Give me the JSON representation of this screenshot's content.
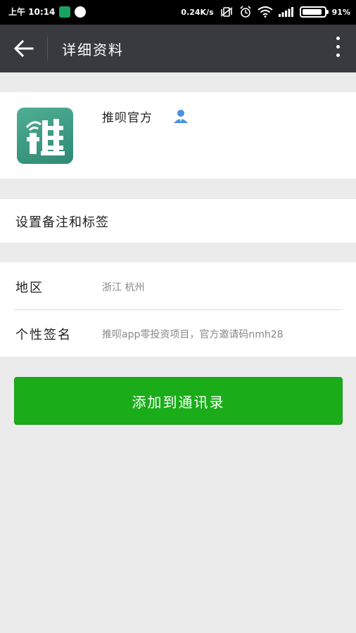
{
  "status_bar": {
    "time": "上午 10:14",
    "net_speed": "0.24K/s",
    "battery": "91%"
  },
  "header": {
    "title": "详细资料"
  },
  "profile": {
    "name": "推呗官方",
    "logo_text": "推"
  },
  "remark": {
    "label": "设置备注和标签"
  },
  "info": {
    "region_label": "地区",
    "region_value": "浙江  杭州",
    "signature_label": "个性签名",
    "signature_value": "推呗app零投资项目，官方邀请码nmh28"
  },
  "actions": {
    "add_contact_label": "添加到通讯录"
  },
  "colors": {
    "status_bar": "#000000",
    "title_bar": "#393a3f",
    "background": "#ebebeb",
    "primary_button": "#1aad19",
    "logo": "#3f9e85"
  }
}
